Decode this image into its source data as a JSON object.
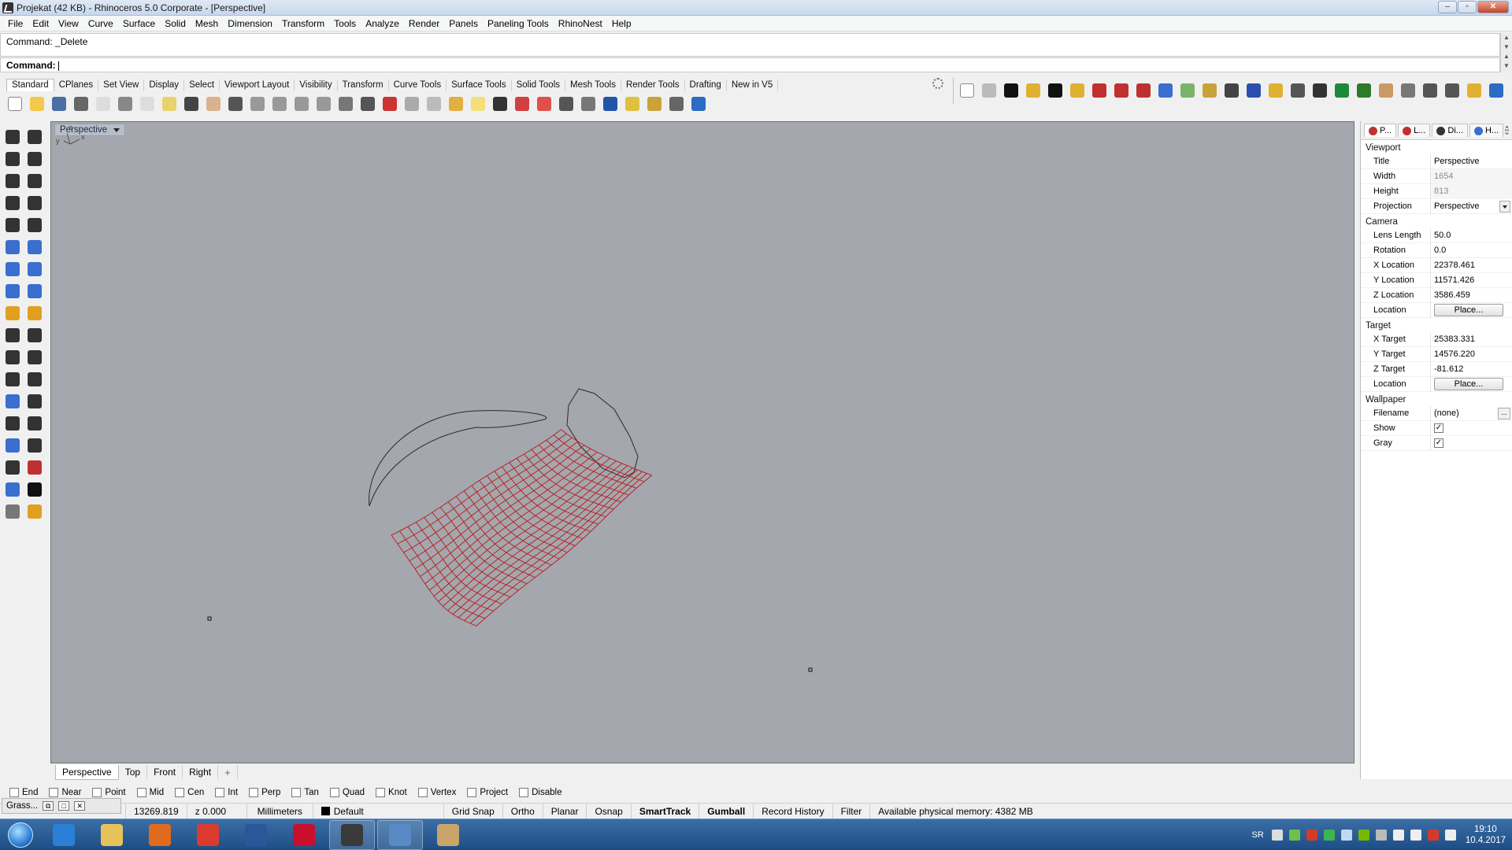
{
  "window": {
    "title": "Projekat (42 KB) - Rhinoceros  5.0 Corporate - [Perspective]",
    "buttons": [
      "–",
      "▫",
      "✕"
    ]
  },
  "menu": [
    "File",
    "Edit",
    "View",
    "Curve",
    "Surface",
    "Solid",
    "Mesh",
    "Dimension",
    "Transform",
    "Tools",
    "Analyze",
    "Render",
    "Panels",
    "Paneling Tools",
    "RhinoNest",
    "Help"
  ],
  "command": {
    "history": "Command: _Delete",
    "prompt": "Command:"
  },
  "toolbar_tabs": [
    "Standard",
    "CPlanes",
    "Set View",
    "Display",
    "Select",
    "Viewport Layout",
    "Visibility",
    "Transform",
    "Curve Tools",
    "Surface Tools",
    "Solid Tools",
    "Mesh Tools",
    "Render Tools",
    "Drafting",
    "New in V5"
  ],
  "standard_icons": [
    {
      "name": "new-icon",
      "color": "#ffffff"
    },
    {
      "name": "open-icon",
      "color": "#f2c94c"
    },
    {
      "name": "save-icon",
      "color": "#4a6fa5"
    },
    {
      "name": "print-icon",
      "color": "#666666"
    },
    {
      "name": "export-icon",
      "color": "#dddddd"
    },
    {
      "name": "cut-icon",
      "color": "#888888"
    },
    {
      "name": "copy-icon",
      "color": "#dddddd"
    },
    {
      "name": "paste-icon",
      "color": "#e8d36a"
    },
    {
      "name": "undo-icon",
      "color": "#444444"
    },
    {
      "name": "pan-icon",
      "color": "#d9b38c"
    },
    {
      "name": "rotate-view-icon",
      "color": "#555555"
    },
    {
      "name": "zoom-icon",
      "color": "#999999"
    },
    {
      "name": "zoom-window-icon",
      "color": "#999999"
    },
    {
      "name": "zoom-extents-icon",
      "color": "#999999"
    },
    {
      "name": "zoom-selected-icon",
      "color": "#999999"
    },
    {
      "name": "undo-view-icon",
      "color": "#777777"
    },
    {
      "name": "grid-icon",
      "color": "#555555"
    },
    {
      "name": "car-icon",
      "color": "#cc3333"
    },
    {
      "name": "plane-icon",
      "color": "#aaaaaa"
    },
    {
      "name": "circle-snap-icon",
      "color": "#bbbbbb"
    },
    {
      "name": "points-icon",
      "color": "#e0b040"
    },
    {
      "name": "light-icon",
      "color": "#f3e07a"
    },
    {
      "name": "lock-icon",
      "color": "#333333"
    },
    {
      "name": "layer-icon",
      "color": "#d04040"
    },
    {
      "name": "color-wheel-icon",
      "color": "#e0504a"
    },
    {
      "name": "shade-icon",
      "color": "#555555"
    },
    {
      "name": "render-sphere-icon",
      "color": "#777777"
    },
    {
      "name": "material-sphere-icon",
      "color": "#2255aa"
    },
    {
      "name": "filter-icon",
      "color": "#e0c040"
    },
    {
      "name": "options-gear-icon",
      "color": "#c9a23a"
    },
    {
      "name": "dimension-icon",
      "color": "#666666"
    },
    {
      "name": "help-icon",
      "color": "#2b6cc4"
    }
  ],
  "right_icons": [
    {
      "name": "nest-icon",
      "color": "#ffffff"
    },
    {
      "name": "notes-icon",
      "color": "#bbbbbb"
    },
    {
      "name": "rhinonest-1-icon",
      "color": "#111111"
    },
    {
      "name": "rhinonest-2-icon",
      "color": "#e0b030"
    },
    {
      "name": "rhinonest-3-icon",
      "color": "#111111"
    },
    {
      "name": "rhinonest-4-icon",
      "color": "#e0b030"
    },
    {
      "name": "rhinonest-5-icon",
      "color": "#c03030"
    },
    {
      "name": "rhinonest-6-icon",
      "color": "#c03030"
    },
    {
      "name": "rhinonest-7-icon",
      "color": "#c03030"
    },
    {
      "name": "rhinonest-8-icon",
      "color": "#3a6ecf"
    },
    {
      "name": "rhinonest-9-icon",
      "color": "#7ab36a"
    },
    {
      "name": "rhinonest-10-icon",
      "color": "#c9a23a"
    },
    {
      "name": "rhinonest-11-icon",
      "color": "#444444"
    },
    {
      "name": "rhinonest-12-icon",
      "color": "#2b4fb0"
    },
    {
      "name": "rhinonest-13-icon",
      "color": "#e0b030"
    },
    {
      "name": "rhinonest-14-icon",
      "color": "#555555"
    },
    {
      "name": "rhinonest-15-icon",
      "color": "#333333"
    },
    {
      "name": "rhinonest-16-icon",
      "color": "#1a8a3a"
    },
    {
      "name": "rhinonest-17-icon",
      "color": "#2c7a2c"
    },
    {
      "name": "rhinonest-18-icon",
      "color": "#cc9966"
    },
    {
      "name": "rhinonest-19-icon",
      "color": "#777777"
    },
    {
      "name": "svg-export-icon",
      "color": "#555555"
    },
    {
      "name": "hpgl-export-icon",
      "color": "#555555"
    },
    {
      "name": "folder-icon",
      "color": "#e0b030"
    },
    {
      "name": "rhinonest-help-icon",
      "color": "#2b6cc4"
    }
  ],
  "left_tools": [
    {
      "name": "select-arrow-icon",
      "color": "#333333"
    },
    {
      "name": "point-icon",
      "color": "#333333"
    },
    {
      "name": "polyline-icon",
      "color": "#333333"
    },
    {
      "name": "curve-cv-icon",
      "color": "#333333"
    },
    {
      "name": "circle-icon",
      "color": "#333333"
    },
    {
      "name": "ellipse-icon",
      "color": "#333333"
    },
    {
      "name": "polygon-icon",
      "color": "#333333"
    },
    {
      "name": "rectangle-icon",
      "color": "#333333"
    },
    {
      "name": "arc-icon",
      "color": "#333333"
    },
    {
      "name": "fillet-curve-icon",
      "color": "#333333"
    },
    {
      "name": "surface-points-icon",
      "color": "#3a6ecf"
    },
    {
      "name": "surface-edge-icon",
      "color": "#3a6ecf"
    },
    {
      "name": "box-icon",
      "color": "#3a6ecf"
    },
    {
      "name": "boolean-icon",
      "color": "#3a6ecf"
    },
    {
      "name": "cylinder-icon",
      "color": "#3a6ecf"
    },
    {
      "name": "extrude-icon",
      "color": "#3a6ecf"
    },
    {
      "name": "explode-icon",
      "color": "#e0a020"
    },
    {
      "name": "split-icon",
      "color": "#e0a020"
    },
    {
      "name": "trim-icon",
      "color": "#333333"
    },
    {
      "name": "join-icon",
      "color": "#333333"
    },
    {
      "name": "group-icon",
      "color": "#333333"
    },
    {
      "name": "ungroup-icon",
      "color": "#333333"
    },
    {
      "name": "offset-icon",
      "color": "#333333"
    },
    {
      "name": "move-icon",
      "color": "#333333"
    },
    {
      "name": "text-icon",
      "color": "#3a6ecf"
    },
    {
      "name": "scale-icon",
      "color": "#333333"
    },
    {
      "name": "array-icon",
      "color": "#333333"
    },
    {
      "name": "dimension-left-icon",
      "color": "#333333"
    },
    {
      "name": "mesh-icon",
      "color": "#3a6ecf"
    },
    {
      "name": "hatch-icon",
      "color": "#333333"
    },
    {
      "name": "grid-array-icon",
      "color": "#333333"
    },
    {
      "name": "block-icon",
      "color": "#c03030"
    },
    {
      "name": "analyze-icon",
      "color": "#3a6ecf"
    },
    {
      "name": "check-icon",
      "color": "#111111"
    },
    {
      "name": "render-left-icon",
      "color": "#777777"
    },
    {
      "name": "drafting-left-icon",
      "color": "#e0a020"
    }
  ],
  "viewport": {
    "label": "Perspective",
    "axis_labels": {
      "y": "y",
      "z": "z",
      "x": "x"
    }
  },
  "viewport_tabs": [
    "Perspective",
    "Top",
    "Front",
    "Right",
    "+"
  ],
  "panel": {
    "tabs": [
      {
        "label": "P...",
        "color": "#c03030"
      },
      {
        "label": "L...",
        "color": "#c03030"
      },
      {
        "label": "Di...",
        "color": "#333333"
      },
      {
        "label": "H...",
        "color": "#3a6ecf"
      }
    ],
    "sections": {
      "viewport": "Viewport",
      "camera": "Camera",
      "target": "Target",
      "wallpaper": "Wallpaper"
    },
    "viewport_rows": [
      {
        "label": "Title",
        "value": "Perspective"
      },
      {
        "label": "Width",
        "value": "1654"
      },
      {
        "label": "Height",
        "value": "813"
      },
      {
        "label": "Projection",
        "value": "Perspective"
      }
    ],
    "camera_rows": [
      {
        "label": "Lens Length",
        "value": "50.0"
      },
      {
        "label": "Rotation",
        "value": "0.0"
      },
      {
        "label": "X Location",
        "value": "22378.461"
      },
      {
        "label": "Y Location",
        "value": "11571.426"
      },
      {
        "label": "Z Location",
        "value": "3586.459"
      },
      {
        "label": "Location",
        "value": "Place..."
      }
    ],
    "target_rows": [
      {
        "label": "X Target",
        "value": "25383.331"
      },
      {
        "label": "Y Target",
        "value": "14576.220"
      },
      {
        "label": "Z Target",
        "value": "-81.612"
      },
      {
        "label": "Location",
        "value": "Place..."
      }
    ],
    "wallpaper_rows": [
      {
        "label": "Filename",
        "value": "(none)"
      },
      {
        "label": "Show",
        "value": "✓"
      },
      {
        "label": "Gray",
        "value": "✓"
      }
    ]
  },
  "osnap": [
    "End",
    "Near",
    "Point",
    "Mid",
    "Cen",
    "Int",
    "Perp",
    "Tan",
    "Quad",
    "Knot",
    "Vertex",
    "Project",
    "Disable"
  ],
  "status": {
    "mini_window": "Grass...",
    "x": "13269.819",
    "z": "z 0.000",
    "units": "Millimeters",
    "layer": "Default",
    "grid_snap": "Grid Snap",
    "ortho": "Ortho",
    "planar": "Planar",
    "osnap": "Osnap",
    "smarttrack": "SmartTrack",
    "gumball": "Gumball",
    "record_history": "Record History",
    "filter": "Filter",
    "memory": "Available physical memory: 4382 MB"
  },
  "taskbar": {
    "apps": [
      {
        "name": "ie-icon",
        "color": "#2b7fd6",
        "open": false
      },
      {
        "name": "explorer-icon",
        "color": "#e7c25a",
        "open": false
      },
      {
        "name": "media-player-icon",
        "color": "#e06b1e",
        "open": false
      },
      {
        "name": "chrome-icon",
        "color": "#db3b2f",
        "open": false
      },
      {
        "name": "word-icon",
        "color": "#2b579a",
        "open": false
      },
      {
        "name": "autocad-icon",
        "color": "#c8102e",
        "open": false
      },
      {
        "name": "rhino-icon",
        "color": "#3a3a3a",
        "open": true
      },
      {
        "name": "screenshot-app-icon",
        "color": "#5a8ac6",
        "open": true
      },
      {
        "name": "paint-icon",
        "color": "#c9a56a",
        "open": false
      }
    ],
    "lang": "SR",
    "tray_icons": [
      {
        "name": "keyboard-tray-icon",
        "color": "#dddddd"
      },
      {
        "name": "network-tray-icon",
        "color": "#6fbf4b"
      },
      {
        "name": "pdf-tray-icon",
        "color": "#d23b2c"
      },
      {
        "name": "autodesk-tray-icon",
        "color": "#3fb34f"
      },
      {
        "name": "display-tray-icon",
        "color": "#c3d8f0"
      },
      {
        "name": "nvidia-tray-icon",
        "color": "#76b900"
      },
      {
        "name": "device-tray-icon",
        "color": "#bbbbbb"
      },
      {
        "name": "update-tray-icon",
        "color": "#eeeeee"
      },
      {
        "name": "flag-tray-icon",
        "color": "#eeeeee"
      },
      {
        "name": "antivirus-tray-icon",
        "color": "#d23b2c"
      },
      {
        "name": "volume-tray-icon",
        "color": "#eeeeee"
      }
    ],
    "time": "19:10",
    "date": "10.4.2017"
  }
}
